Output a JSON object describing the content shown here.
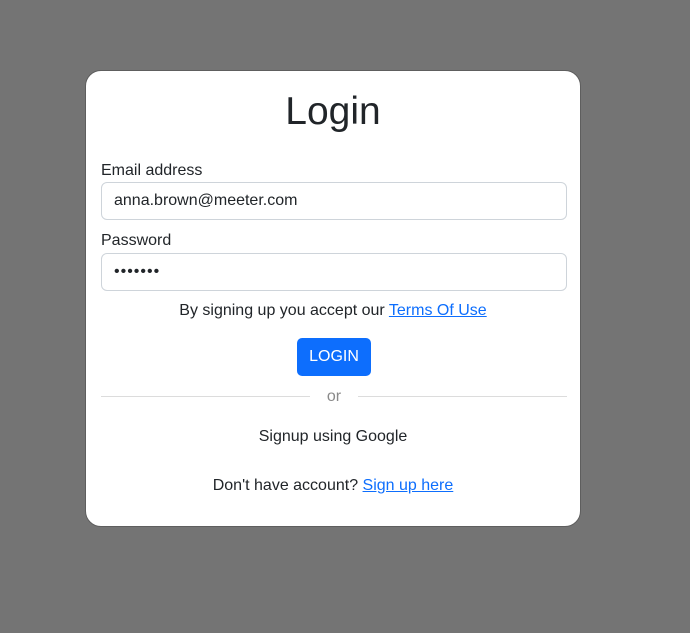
{
  "login": {
    "title": "Login",
    "email_label": "Email address",
    "email_value": "anna.brown@meeter.com",
    "password_label": "Password",
    "password_value": "1234567",
    "terms_prefix": "By signing up you accept our ",
    "terms_link": "Terms Of Use",
    "login_button": "LOGIN",
    "divider_text": "or",
    "google_signup": "Signup using Google",
    "signup_prefix": "Don't have account? ",
    "signup_link": "Sign up here"
  },
  "colors": {
    "background": "#747474",
    "card": "#ffffff",
    "primary": "#0d6efd",
    "text": "#212529",
    "muted": "#8a8a8a"
  }
}
